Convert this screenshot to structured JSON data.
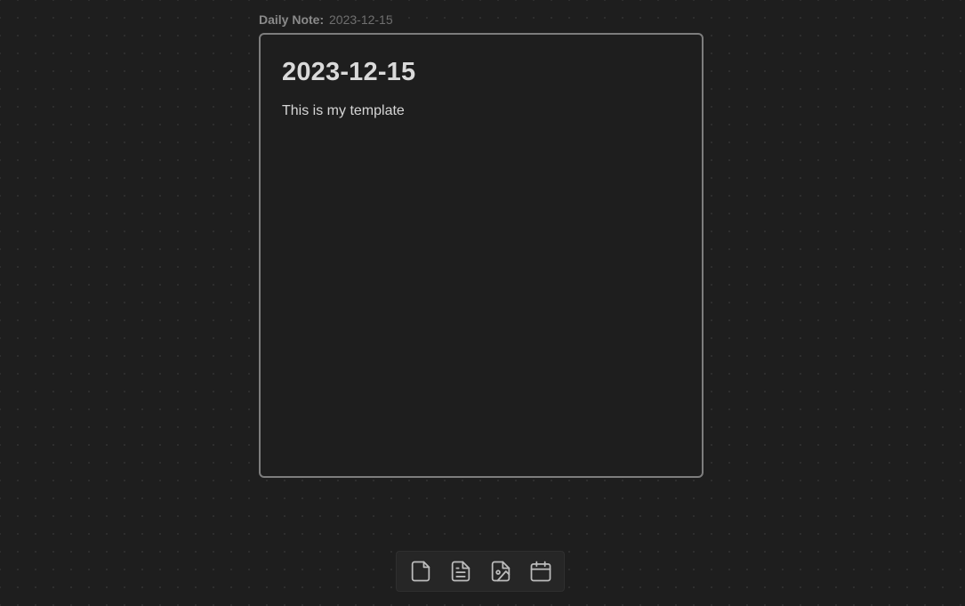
{
  "card": {
    "label_key": "Daily Note:",
    "label_value": "2023-12-15",
    "title": "2023-12-15",
    "body": "This is my template"
  },
  "toolbar": {
    "items": [
      {
        "icon": "file-icon"
      },
      {
        "icon": "note-icon"
      },
      {
        "icon": "image-file-icon"
      },
      {
        "icon": "calendar-icon"
      }
    ]
  },
  "colors": {
    "background": "#1e1e1e",
    "card_border": "#7d7d7d",
    "text": "#dadada"
  }
}
